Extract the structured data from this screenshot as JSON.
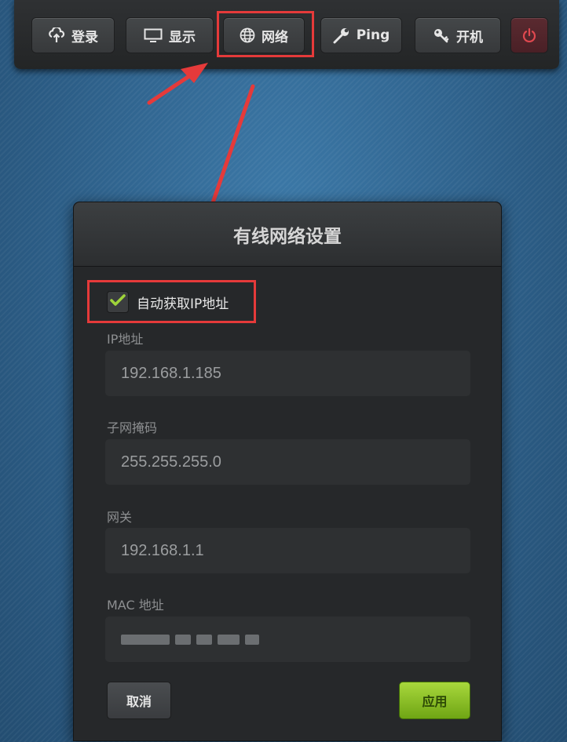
{
  "toolbar": {
    "login_label": "登录",
    "display_label": "显示",
    "network_label": "网络",
    "ping_label": "Ping",
    "boot_label": "开机"
  },
  "icons": {
    "login": "cloud-upload-icon",
    "display": "monitor-icon",
    "network": "globe-icon",
    "ping": "wrench-icon",
    "boot": "key-icon",
    "power": "power-icon",
    "check": "checkmark-icon"
  },
  "dialog": {
    "title": "有线网络设置",
    "auto_ip_label": "自动获取IP地址",
    "auto_ip_checked": true,
    "ip_label": "IP地址",
    "ip_value": "192.168.1.185",
    "subnet_label": "子网掩码",
    "subnet_value": "255.255.255.0",
    "gateway_label": "网关",
    "gateway_value": "192.168.1.1",
    "mac_label": "MAC 地址",
    "cancel_label": "取消",
    "apply_label": "应用"
  },
  "colors": {
    "highlight": "#e53a3a",
    "apply_green": "#8cc224",
    "background_blue": "#2f5f86"
  }
}
